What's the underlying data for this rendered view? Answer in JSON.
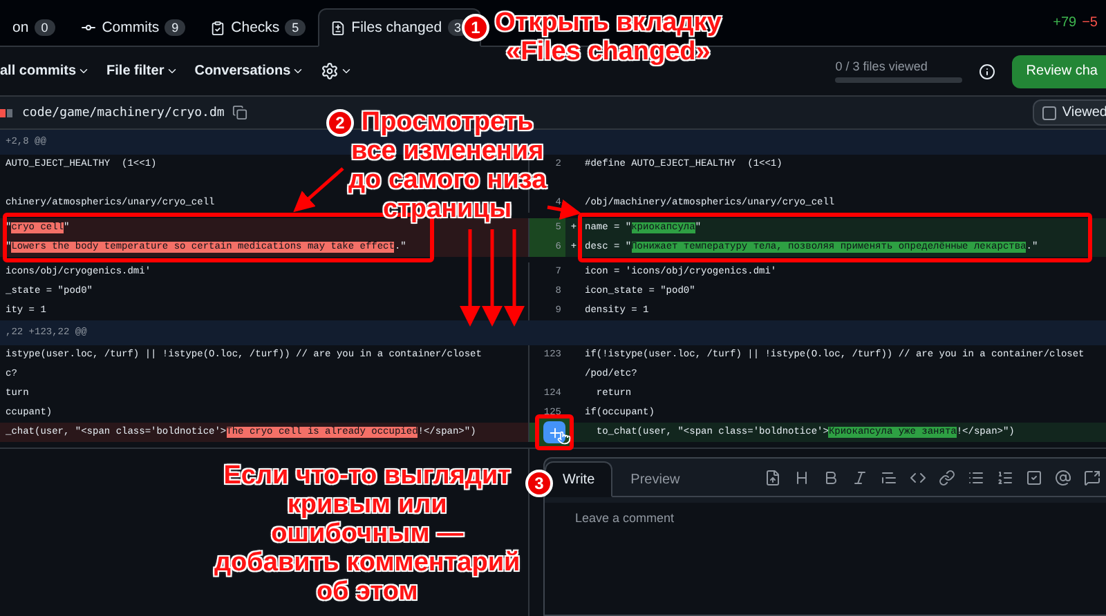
{
  "tabs": [
    {
      "kind": "conversation",
      "label": "on",
      "count": "0",
      "selected": false
    },
    {
      "kind": "commits",
      "label": "Commits",
      "count": "9",
      "selected": false
    },
    {
      "kind": "checks",
      "label": "Checks",
      "count": "5",
      "selected": false
    },
    {
      "kind": "files",
      "label": "Files changed",
      "count": "3",
      "selected": true
    }
  ],
  "diffstat": {
    "added": "+79",
    "removed": "−5"
  },
  "toolbar": {
    "menus": [
      "all commits",
      "File filter",
      "Conversations"
    ],
    "files_viewed": {
      "text": "0 / 3 files viewed",
      "level": 0
    },
    "review_button": "Review cha"
  },
  "file": {
    "path": "code/game/machinery/cryo.dm",
    "viewed": {
      "label": "Viewed",
      "checked": false
    }
  },
  "diff": {
    "rows": [
      {
        "kind": "hunk",
        "left": "+2,8 @@"
      },
      {
        "kind": "context",
        "left": "AUTO_EJECT_HEALTHY  (1<<1)",
        "right_num": "2",
        "right": "#define AUTO_EJECT_HEALTHY  (1<<1)"
      },
      {
        "kind": "context"
      },
      {
        "kind": "context",
        "left": "chinery/atmospherics/unary/cryo_cell",
        "right_num": "4",
        "right": "/obj/machinery/atmospherics/unary/cryo_cell"
      },
      {
        "kind": "change",
        "framed": true,
        "left": [
          {
            "text": "\"",
            "changed": false
          },
          {
            "text": "cryo cell",
            "changed": true
          },
          {
            "text": "\"",
            "changed": false
          }
        ],
        "right_num": "5",
        "marker": "+",
        "right": [
          {
            "text": "name = \"",
            "changed": false
          },
          {
            "text": "криокапсула",
            "changed": true
          },
          {
            "text": "\"",
            "changed": false
          }
        ]
      },
      {
        "kind": "change",
        "framed": true,
        "left": [
          {
            "text": "\"",
            "changed": false
          },
          {
            "text": "Lowers the body temperature so certain medications may take effect",
            "changed": true
          },
          {
            "text": ".\"",
            "changed": false
          }
        ],
        "right_num": "6",
        "marker": "+",
        "right": [
          {
            "text": "desc = \"",
            "changed": false
          },
          {
            "text": "Понижает температуру тела, позволяя применять определённые лекарства",
            "changed": true
          },
          {
            "text": ".\"",
            "changed": false
          }
        ]
      },
      {
        "kind": "context",
        "left": "icons/obj/cryogenics.dmi'",
        "right_num": "7",
        "right": "icon = 'icons/obj/cryogenics.dmi'"
      },
      {
        "kind": "context",
        "left": "_state = \"pod0\"",
        "right_num": "8",
        "right": "icon_state = \"pod0\""
      },
      {
        "kind": "context",
        "left": "ity = 1",
        "right_num": "9",
        "right": "density = 1"
      },
      {
        "kind": "hunk",
        "left": ",22 +123,22 @@"
      },
      {
        "kind": "context",
        "left": "istype(user.loc, /turf) || !istype(O.loc, /turf)) // are you in a container/closet",
        "right_num": "123",
        "right": "if(!istype(user.loc, /turf) || !istype(O.loc, /turf)) // are you in a container/closet"
      },
      {
        "kind": "context",
        "left": "c?",
        "right": "/pod/etc?"
      },
      {
        "kind": "context",
        "left": "turn",
        "right_num": "124",
        "right": "  return"
      },
      {
        "kind": "context",
        "left": "ccupant)",
        "right_num": "125",
        "right": "if(occupant)"
      },
      {
        "kind": "change",
        "add_comment": true,
        "left": [
          {
            "text": "_chat(user, \"<span class='boldnotice'>",
            "changed": false
          },
          {
            "text": "The cryo cell is already occupied",
            "changed": true
          },
          {
            "text": "!</span>\")",
            "changed": false
          }
        ],
        "right": [
          {
            "text": "  to_chat(user, \"<span class='boldnotice'>",
            "changed": false
          },
          {
            "text": "Криокапсула уже занята",
            "changed": true
          },
          {
            "text": "!</span>\")",
            "changed": false
          }
        ]
      }
    ]
  },
  "comment": {
    "tabs": [
      {
        "label": "Write",
        "selected": true
      },
      {
        "label": "Preview",
        "selected": false
      }
    ],
    "placeholder": "Leave a comment"
  },
  "annotations": [
    {
      "number": "1",
      "lines": [
        "Открыть вкладку",
        "«Files changed»"
      ]
    },
    {
      "number": "2",
      "lines": [
        "Просмотреть",
        "все изменения",
        "до самого низа",
        "страницы"
      ]
    },
    {
      "number": "3",
      "lines": [
        "Если что-то выглядит",
        "кривым или",
        "ошибочным —",
        "добавить комментарий",
        "об этом"
      ]
    }
  ]
}
